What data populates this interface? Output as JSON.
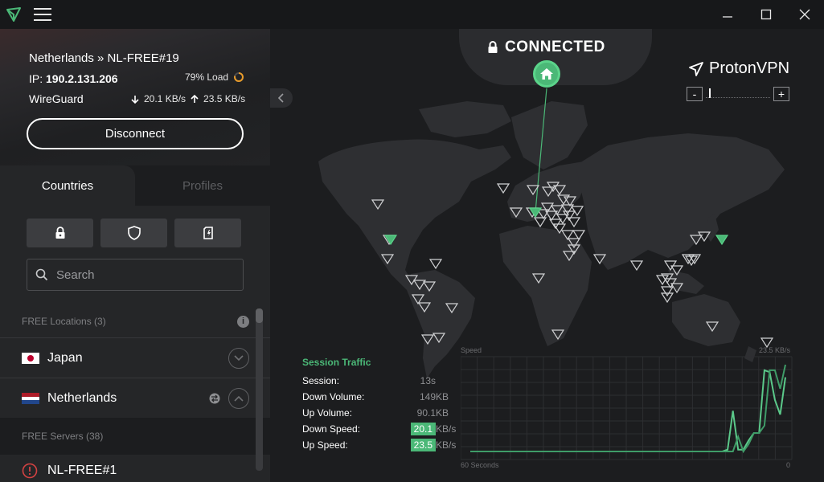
{
  "titlebar": {
    "logo_icon": "protonvpn-logo-icon",
    "menu_icon": "hamburger-menu-icon",
    "minimize_icon": "minimize-icon",
    "maximize_icon": "maximize-icon",
    "close_icon": "close-icon"
  },
  "connection": {
    "server": "Netherlands » NL-FREE#19",
    "ip_label": "IP:",
    "ip": "190.2.131.206",
    "load": "79% Load",
    "load_fraction": 0.79,
    "protocol": "WireGuard",
    "down_speed": "20.1 KB/s",
    "up_speed": "23.5 KB/s",
    "disconnect_label": "Disconnect"
  },
  "tabs": [
    {
      "label": "Countries",
      "active": true
    },
    {
      "label": "Profiles",
      "active": false
    }
  ],
  "filters": [
    {
      "icon": "lock-icon"
    },
    {
      "icon": "shield-icon"
    },
    {
      "icon": "sd-card-icon"
    }
  ],
  "search": {
    "placeholder": "Search",
    "value": ""
  },
  "list": {
    "free_locations_header": "FREE Locations (3)",
    "countries": [
      {
        "name": "Japan",
        "flag": "japan-flag-icon",
        "expanded": false
      },
      {
        "name": "Netherlands",
        "flag": "netherlands-flag-icon",
        "expanded": true
      }
    ],
    "free_servers_header": "FREE Servers (38)",
    "servers": [
      {
        "name": "NL-FREE#1",
        "icon": "info-circle-icon"
      }
    ]
  },
  "map": {
    "status": "CONNECTED",
    "brand": "ProtonVPN",
    "zoom_minus": "-",
    "zoom_plus": "+",
    "zoom_level": 0.05
  },
  "traffic": {
    "title": "Session Traffic",
    "rows": [
      {
        "label": "Session:",
        "value": "13s",
        "unit": "",
        "highlight": false
      },
      {
        "label": "Down Volume:",
        "value": "149",
        "unit": "KB",
        "highlight": false
      },
      {
        "label": "Up Volume:",
        "value": "90.1",
        "unit": "KB",
        "highlight": false
      },
      {
        "label": "Down Speed:",
        "value": "20.1",
        "unit": "KB/s",
        "highlight": true
      },
      {
        "label": "Up Speed:",
        "value": "23.5",
        "unit": "KB/s",
        "highlight": true
      }
    ]
  },
  "chart_data": {
    "type": "line",
    "ylabel": "Speed",
    "ymax_label": "23.5 KB/s",
    "xlabel_left": "60 Seconds",
    "xlabel_right": "0",
    "x": [
      60,
      50,
      40,
      30,
      20,
      15,
      13,
      12,
      11,
      10,
      9,
      8,
      7,
      6,
      5,
      4,
      3,
      2,
      1,
      0
    ],
    "ylim": [
      0,
      23.5
    ],
    "series": [
      {
        "name": "Download",
        "values": [
          0,
          0,
          0,
          0,
          0,
          0,
          0,
          0,
          0.5,
          11,
          0.5,
          0.5,
          3,
          5,
          5,
          22,
          21.5,
          14,
          10,
          20.1
        ]
      },
      {
        "name": "Upload",
        "values": [
          0,
          0,
          0,
          0,
          0,
          0,
          0,
          0,
          0,
          0,
          4,
          0,
          2,
          5,
          5,
          7,
          22,
          22,
          17,
          23.5
        ]
      }
    ],
    "grid": true
  }
}
